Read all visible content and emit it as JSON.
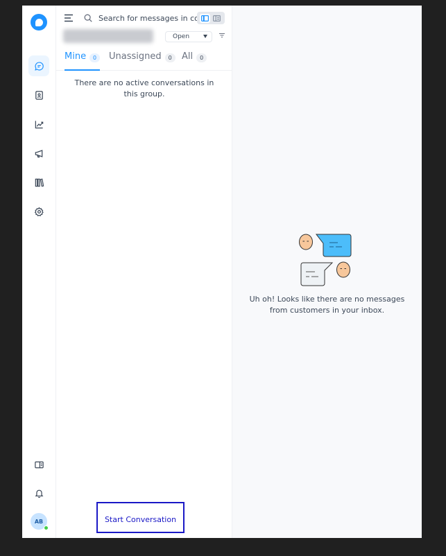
{
  "nav": {
    "items": [
      {
        "name": "conversations-nav",
        "icon": "chat-bubble-icon",
        "active": true
      },
      {
        "name": "contacts-nav",
        "icon": "contact-book-icon",
        "active": false
      },
      {
        "name": "reports-nav",
        "icon": "chart-line-icon",
        "active": false
      },
      {
        "name": "campaigns-nav",
        "icon": "megaphone-icon",
        "active": false
      },
      {
        "name": "library-nav",
        "icon": "books-icon",
        "active": false
      },
      {
        "name": "settings-nav",
        "icon": "gear-icon",
        "active": false
      }
    ],
    "user_initials": "AB",
    "presence_color": "#44ce4b"
  },
  "search": {
    "placeholder": "Search for messages in conversations"
  },
  "filters": {
    "status_value": "Open"
  },
  "tabs": [
    {
      "label": "Mine",
      "count": "0",
      "active": true
    },
    {
      "label": "Unassigned",
      "count": "0",
      "active": false
    },
    {
      "label": "All",
      "count": "0",
      "active": false
    }
  ],
  "list": {
    "empty_text": "There are no active conversations in this group.",
    "start_button_label": "Start Conversation"
  },
  "main": {
    "empty_text": "Uh oh! Looks like there are no messages from customers in your inbox."
  },
  "colors": {
    "accent": "#1f93ff",
    "start_button": "#1a18c6"
  }
}
